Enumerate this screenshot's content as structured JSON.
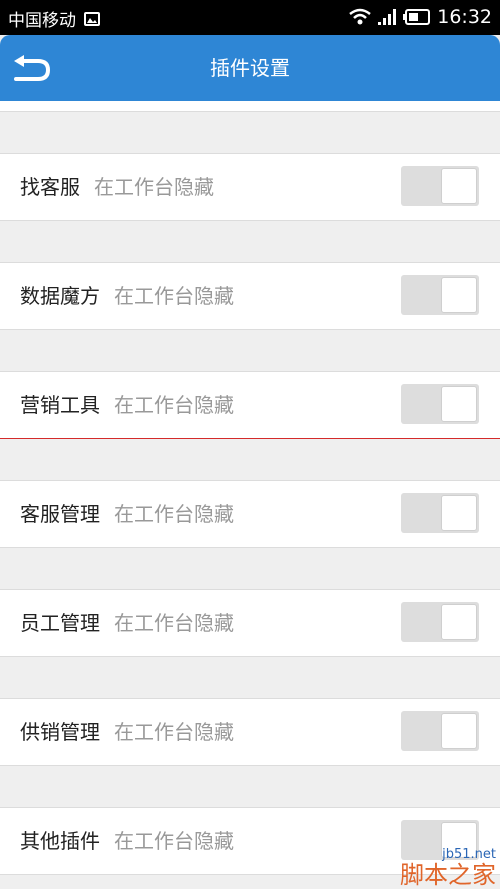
{
  "status_bar": {
    "carrier": "中国移动",
    "time": "16:32"
  },
  "app_bar": {
    "title": "插件设置",
    "back_icon": "back-arrow-icon"
  },
  "settings": [
    {
      "name": "找客服",
      "description": "在工作台隐藏",
      "toggle_state": "off"
    },
    {
      "name": "数据魔方",
      "description": "在工作台隐藏",
      "toggle_state": "off"
    },
    {
      "name": "营销工具",
      "description": "在工作台隐藏",
      "toggle_state": "off"
    },
    {
      "name": "客服管理",
      "description": "在工作台隐藏",
      "toggle_state": "off"
    },
    {
      "name": "员工管理",
      "description": "在工作台隐藏",
      "toggle_state": "off"
    },
    {
      "name": "供销管理",
      "description": "在工作台隐藏",
      "toggle_state": "off"
    },
    {
      "name": "其他插件",
      "description": "在工作台隐藏",
      "toggle_state": "off"
    }
  ],
  "watermark": {
    "site": "jb51.net",
    "brand": "脚本之家"
  },
  "colors": {
    "app_bar": "#2e86d5",
    "toggle_track": "#dddddd",
    "focus_underline": "#d42a2a",
    "background": "#efefef"
  }
}
